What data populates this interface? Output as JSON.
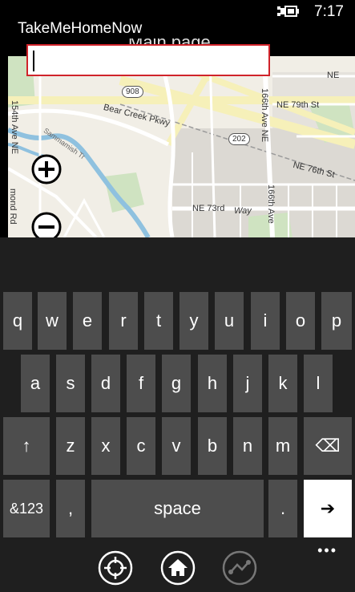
{
  "status": {
    "time": "7:17",
    "battery_icon": "battery-charging-icon"
  },
  "app": {
    "title": "TakeMeHomeNow",
    "page_title_partial": "Main page"
  },
  "search": {
    "value": "",
    "placeholder": ""
  },
  "map": {
    "labels": {
      "bear_creek": "Bear Creek Pkwy",
      "ne_79th": "NE 79th St",
      "ne_76th": "NE 76th St",
      "ne_73rd": "NE 73rd",
      "way": "Way",
      "avenue_166_a": "166th Ave NE",
      "avenue_166_b": "166th Ave",
      "ave_154": "154th Ave NE",
      "ne_top": "NE",
      "mond_rd": "mond Rd",
      "sammamish_trail": "Sammamish Tr"
    },
    "shields": {
      "r908": "908",
      "r202": "202"
    },
    "colors": {
      "land": "#f1eee6",
      "road": "#ffffff",
      "highway": "#f6f0b9",
      "water": "#8fc1df",
      "park": "#cfe3c1",
      "urban": "#dcd9d3"
    }
  },
  "zoom": {
    "in_icon": "zoom-in-icon",
    "out_icon": "zoom-out-icon"
  },
  "keyboard": {
    "row1": [
      "q",
      "w",
      "e",
      "r",
      "t",
      "y",
      "u",
      "i",
      "o",
      "p"
    ],
    "row2": [
      "a",
      "s",
      "d",
      "f",
      "g",
      "h",
      "j",
      "k",
      "l"
    ],
    "row3": [
      "z",
      "x",
      "c",
      "v",
      "b",
      "n",
      "m"
    ],
    "shift_symbol": "↑",
    "backspace_symbol": "⌫",
    "symbols_label": "&123",
    "comma_label": ",",
    "space_label": "space",
    "period_label": ".",
    "enter_symbol": "➔"
  },
  "app_bar": {
    "locate_icon": "crosshair-icon",
    "home_icon": "home-icon",
    "route_icon": "route-icon",
    "more_label": "•••"
  }
}
